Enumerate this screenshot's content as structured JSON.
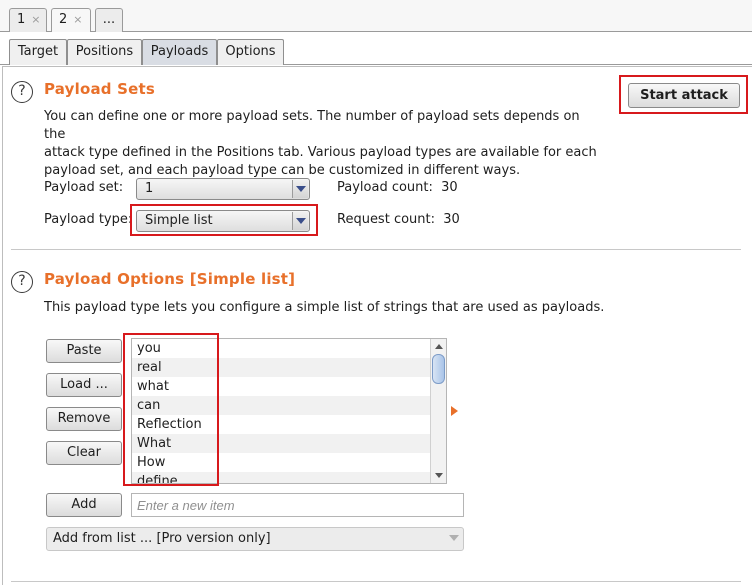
{
  "instance_tabs": [
    {
      "label": "1",
      "close": "×"
    },
    {
      "label": "2",
      "close": "×"
    },
    {
      "label": "..."
    }
  ],
  "sub_tabs": [
    "Target",
    "Positions",
    "Payloads",
    "Options"
  ],
  "payload_sets": {
    "heading": "Payload Sets",
    "description": [
      "You can define one or more payload sets. The number of payload sets depends on the",
      "attack type defined in the Positions tab. Various payload types are available for each",
      "payload set, and each payload type can be customized in different ways."
    ],
    "start_attack": "Start attack",
    "set_label": "Payload set:",
    "set_value": "1",
    "type_label": "Payload type:",
    "type_value": "Simple list",
    "count_label": "Payload count:",
    "count_value": "30",
    "request_label": "Request count:",
    "request_value": "30"
  },
  "payload_options": {
    "heading": "Payload Options [Simple list]",
    "description": "This payload type lets you configure a simple list of strings that are used as payloads.",
    "buttons": {
      "paste": "Paste",
      "load": "Load ...",
      "remove": "Remove",
      "clear": "Clear",
      "add": "Add"
    },
    "items": [
      "you",
      "real",
      "what",
      "can",
      "Reflection",
      "What",
      "How",
      "define"
    ],
    "new_item_placeholder": "Enter a new item",
    "add_from_list": "Add from list ... [Pro version only]"
  },
  "colors": {
    "accent": "#e8702a",
    "highlight_box": "#d7191c"
  }
}
